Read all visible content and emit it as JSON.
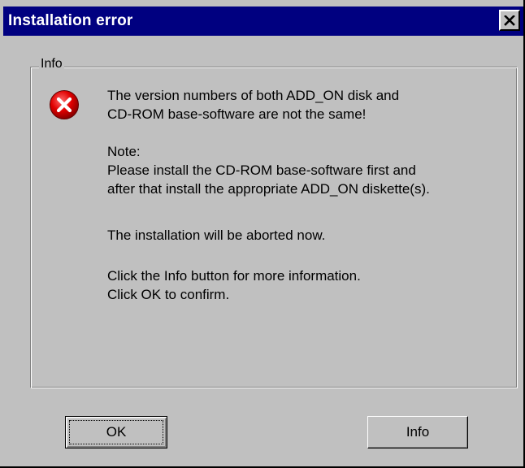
{
  "window": {
    "title": "Installation error",
    "close_symbol": "close-icon"
  },
  "group": {
    "label": "Info"
  },
  "icon": {
    "name": "error-icon",
    "color": "#e00000"
  },
  "message": {
    "line1": "The version numbers of both ADD_ON disk and",
    "line2": "CD-ROM base-software are not the same!",
    "note_label": "Note:",
    "note_line1": "Please install the  CD-ROM base-software first and",
    "note_line2": "after that install the appropriate ADD_ON diskette(s).",
    "abort_line": "The installation will be aborted now.",
    "info_line": "Click the Info button for more information.",
    "confirm_line": "Click OK to confirm."
  },
  "buttons": {
    "ok_label": "OK",
    "info_label": "Info"
  },
  "colors": {
    "titlebar": "#000080",
    "face": "#c0c0c0"
  }
}
